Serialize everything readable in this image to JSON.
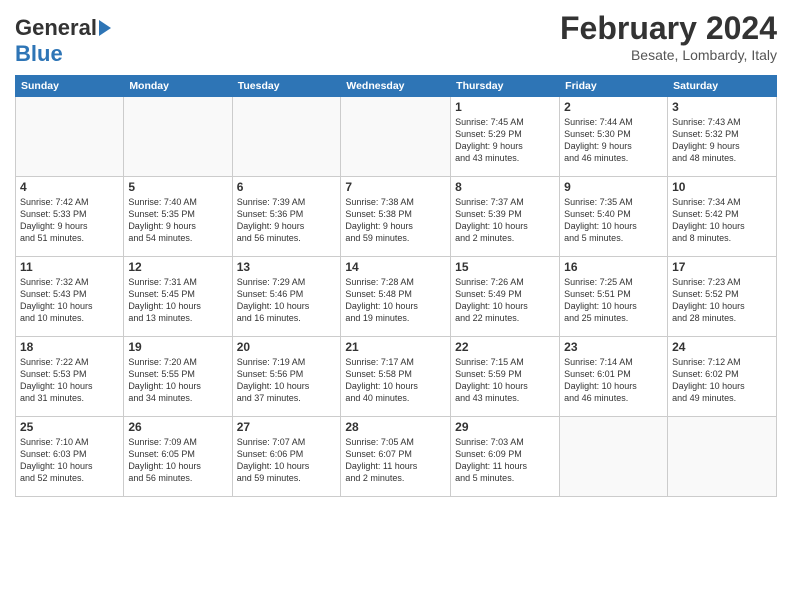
{
  "header": {
    "logo_general": "General",
    "logo_blue": "Blue",
    "title": "February 2024",
    "subtitle": "Besate, Lombardy, Italy"
  },
  "days_of_week": [
    "Sunday",
    "Monday",
    "Tuesday",
    "Wednesday",
    "Thursday",
    "Friday",
    "Saturday"
  ],
  "weeks": [
    [
      {
        "day": "",
        "info": ""
      },
      {
        "day": "",
        "info": ""
      },
      {
        "day": "",
        "info": ""
      },
      {
        "day": "",
        "info": ""
      },
      {
        "day": "1",
        "info": "Sunrise: 7:45 AM\nSunset: 5:29 PM\nDaylight: 9 hours\nand 43 minutes."
      },
      {
        "day": "2",
        "info": "Sunrise: 7:44 AM\nSunset: 5:30 PM\nDaylight: 9 hours\nand 46 minutes."
      },
      {
        "day": "3",
        "info": "Sunrise: 7:43 AM\nSunset: 5:32 PM\nDaylight: 9 hours\nand 48 minutes."
      }
    ],
    [
      {
        "day": "4",
        "info": "Sunrise: 7:42 AM\nSunset: 5:33 PM\nDaylight: 9 hours\nand 51 minutes."
      },
      {
        "day": "5",
        "info": "Sunrise: 7:40 AM\nSunset: 5:35 PM\nDaylight: 9 hours\nand 54 minutes."
      },
      {
        "day": "6",
        "info": "Sunrise: 7:39 AM\nSunset: 5:36 PM\nDaylight: 9 hours\nand 56 minutes."
      },
      {
        "day": "7",
        "info": "Sunrise: 7:38 AM\nSunset: 5:38 PM\nDaylight: 9 hours\nand 59 minutes."
      },
      {
        "day": "8",
        "info": "Sunrise: 7:37 AM\nSunset: 5:39 PM\nDaylight: 10 hours\nand 2 minutes."
      },
      {
        "day": "9",
        "info": "Sunrise: 7:35 AM\nSunset: 5:40 PM\nDaylight: 10 hours\nand 5 minutes."
      },
      {
        "day": "10",
        "info": "Sunrise: 7:34 AM\nSunset: 5:42 PM\nDaylight: 10 hours\nand 8 minutes."
      }
    ],
    [
      {
        "day": "11",
        "info": "Sunrise: 7:32 AM\nSunset: 5:43 PM\nDaylight: 10 hours\nand 10 minutes."
      },
      {
        "day": "12",
        "info": "Sunrise: 7:31 AM\nSunset: 5:45 PM\nDaylight: 10 hours\nand 13 minutes."
      },
      {
        "day": "13",
        "info": "Sunrise: 7:29 AM\nSunset: 5:46 PM\nDaylight: 10 hours\nand 16 minutes."
      },
      {
        "day": "14",
        "info": "Sunrise: 7:28 AM\nSunset: 5:48 PM\nDaylight: 10 hours\nand 19 minutes."
      },
      {
        "day": "15",
        "info": "Sunrise: 7:26 AM\nSunset: 5:49 PM\nDaylight: 10 hours\nand 22 minutes."
      },
      {
        "day": "16",
        "info": "Sunrise: 7:25 AM\nSunset: 5:51 PM\nDaylight: 10 hours\nand 25 minutes."
      },
      {
        "day": "17",
        "info": "Sunrise: 7:23 AM\nSunset: 5:52 PM\nDaylight: 10 hours\nand 28 minutes."
      }
    ],
    [
      {
        "day": "18",
        "info": "Sunrise: 7:22 AM\nSunset: 5:53 PM\nDaylight: 10 hours\nand 31 minutes."
      },
      {
        "day": "19",
        "info": "Sunrise: 7:20 AM\nSunset: 5:55 PM\nDaylight: 10 hours\nand 34 minutes."
      },
      {
        "day": "20",
        "info": "Sunrise: 7:19 AM\nSunset: 5:56 PM\nDaylight: 10 hours\nand 37 minutes."
      },
      {
        "day": "21",
        "info": "Sunrise: 7:17 AM\nSunset: 5:58 PM\nDaylight: 10 hours\nand 40 minutes."
      },
      {
        "day": "22",
        "info": "Sunrise: 7:15 AM\nSunset: 5:59 PM\nDaylight: 10 hours\nand 43 minutes."
      },
      {
        "day": "23",
        "info": "Sunrise: 7:14 AM\nSunset: 6:01 PM\nDaylight: 10 hours\nand 46 minutes."
      },
      {
        "day": "24",
        "info": "Sunrise: 7:12 AM\nSunset: 6:02 PM\nDaylight: 10 hours\nand 49 minutes."
      }
    ],
    [
      {
        "day": "25",
        "info": "Sunrise: 7:10 AM\nSunset: 6:03 PM\nDaylight: 10 hours\nand 52 minutes."
      },
      {
        "day": "26",
        "info": "Sunrise: 7:09 AM\nSunset: 6:05 PM\nDaylight: 10 hours\nand 56 minutes."
      },
      {
        "day": "27",
        "info": "Sunrise: 7:07 AM\nSunset: 6:06 PM\nDaylight: 10 hours\nand 59 minutes."
      },
      {
        "day": "28",
        "info": "Sunrise: 7:05 AM\nSunset: 6:07 PM\nDaylight: 11 hours\nand 2 minutes."
      },
      {
        "day": "29",
        "info": "Sunrise: 7:03 AM\nSunset: 6:09 PM\nDaylight: 11 hours\nand 5 minutes."
      },
      {
        "day": "",
        "info": ""
      },
      {
        "day": "",
        "info": ""
      }
    ]
  ]
}
